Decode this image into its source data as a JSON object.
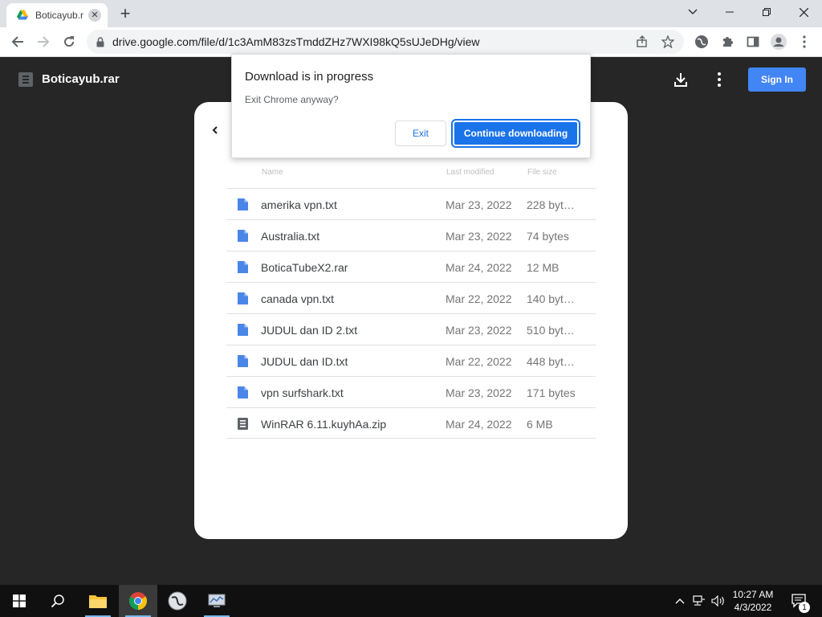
{
  "browser": {
    "tab_title": "Boticayub.r",
    "url": "drive.google.com/file/d/1c3AmM83zsTmddZHz7WXI98kQ5sUJeDHg/view"
  },
  "viewer": {
    "file_name": "Boticayub.rar",
    "signin_label": "Sign In",
    "columns": {
      "name": "Name",
      "modified": "Last modified",
      "size": "File size"
    },
    "files": [
      {
        "name": "amerika vpn.txt",
        "modified": "Mar 23, 2022",
        "size": "228 byt…",
        "icon": "doc-icon"
      },
      {
        "name": "Australia.txt",
        "modified": "Mar 23, 2022",
        "size": "74 bytes",
        "icon": "doc-icon"
      },
      {
        "name": "BoticaTubeX2.rar",
        "modified": "Mar 24, 2022",
        "size": "12 MB",
        "icon": "doc-icon"
      },
      {
        "name": "canada vpn.txt",
        "modified": "Mar 22, 2022",
        "size": "140 byt…",
        "icon": "doc-icon"
      },
      {
        "name": "JUDUL dan ID 2.txt",
        "modified": "Mar 23, 2022",
        "size": "510 byt…",
        "icon": "doc-icon"
      },
      {
        "name": "JUDUL dan ID.txt",
        "modified": "Mar 22, 2022",
        "size": "448 byt…",
        "icon": "doc-icon"
      },
      {
        "name": "vpn surfshark.txt",
        "modified": "Mar 23, 2022",
        "size": "171 bytes",
        "icon": "doc-icon"
      },
      {
        "name": "WinRAR 6.11.kuyhAa.zip",
        "modified": "Mar 24, 2022",
        "size": "6 MB",
        "icon": "archive-icon"
      }
    ]
  },
  "dialog": {
    "title": "Download is in progress",
    "message": "Exit Chrome anyway?",
    "exit_label": "Exit",
    "continue_label": "Continue downloading"
  },
  "taskbar": {
    "time": "10:27 AM",
    "date": "4/3/2022",
    "notification_count": "1"
  },
  "colors": {
    "accent": "#1a73e8",
    "signin": "#4285f4",
    "doc_icon": "#4a86e8",
    "viewer_bg": "#262626"
  }
}
